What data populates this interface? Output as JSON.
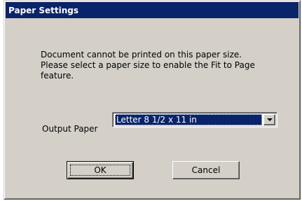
{
  "window": {
    "title": "Paper Settings"
  },
  "message": {
    "line1": "Document cannot be printed on this paper size.",
    "line2": "Please select a paper size to enable the Fit to Page",
    "line3": "feature."
  },
  "output_paper": {
    "label": "Output Paper",
    "selected": "Letter 8 1/2 x 11 in"
  },
  "buttons": {
    "ok": "OK",
    "cancel": "Cancel"
  },
  "colors": {
    "titlebar": "#0a246a",
    "dialog_face": "#d4d0c8",
    "selection": "#0a246a"
  },
  "icons": {
    "dropdown": "chevron-down-icon"
  }
}
